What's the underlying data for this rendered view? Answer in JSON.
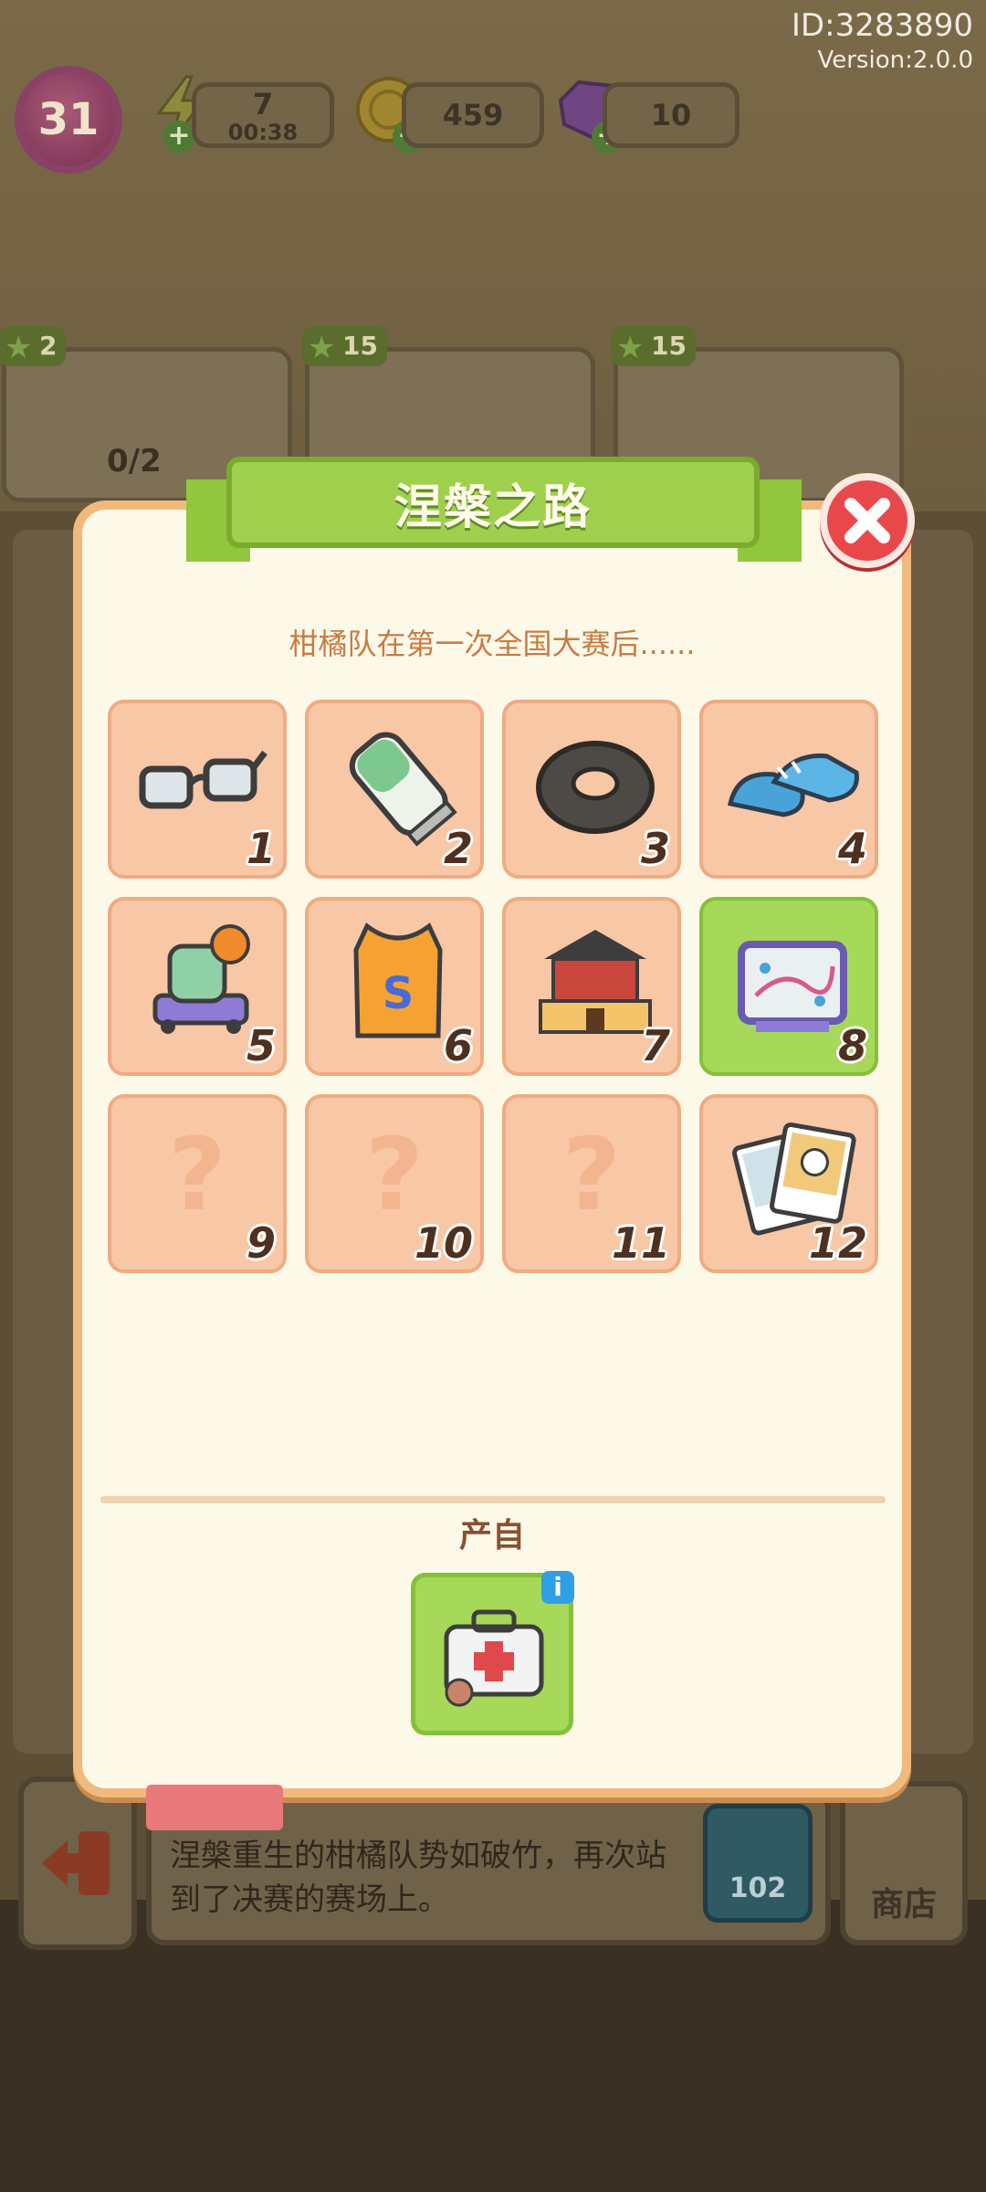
{
  "meta": {
    "id": "ID:3283890",
    "version": "Version:2.0.0"
  },
  "hud": {
    "level": "31",
    "energy": {
      "value": "7",
      "timer": "00:38"
    },
    "coins": "459",
    "gems": "10"
  },
  "task_cards": [
    {
      "stars": "2",
      "progress": "0/2"
    },
    {
      "stars": "15"
    },
    {
      "stars": "15"
    }
  ],
  "modal": {
    "title": "涅槃之路",
    "subtitle": "柑橘队在第一次全国大赛后......",
    "items": [
      {
        "num": "1",
        "icon": "glasses-icon"
      },
      {
        "num": "2",
        "icon": "hair-clipper-icon"
      },
      {
        "num": "3",
        "icon": "tire-icon"
      },
      {
        "num": "4",
        "icon": "sneakers-icon"
      },
      {
        "num": "5",
        "icon": "ball-machine-icon"
      },
      {
        "num": "6",
        "icon": "jersey-icon"
      },
      {
        "num": "7",
        "icon": "building-icon"
      },
      {
        "num": "8",
        "icon": "tactics-board-icon",
        "active": true
      },
      {
        "num": "9",
        "locked": true
      },
      {
        "num": "10",
        "locked": true
      },
      {
        "num": "11",
        "locked": true
      },
      {
        "num": "12",
        "icon": "photos-icon"
      }
    ],
    "locked_symbol": "?",
    "source_label": "产自",
    "source_info": "i"
  },
  "bottom": {
    "description": "涅槃重生的柑橘队势如破竹，再次站到了决赛的赛场上。",
    "coin_count": "102",
    "shop_label": "商店"
  },
  "colors": {
    "modal_bg": "#fcf9e8",
    "modal_border": "#f1ba7d",
    "ribbon": "#9fd04d",
    "cell": "#f8c7a6",
    "cell_active": "#a6d859",
    "close": "#e9484b"
  }
}
